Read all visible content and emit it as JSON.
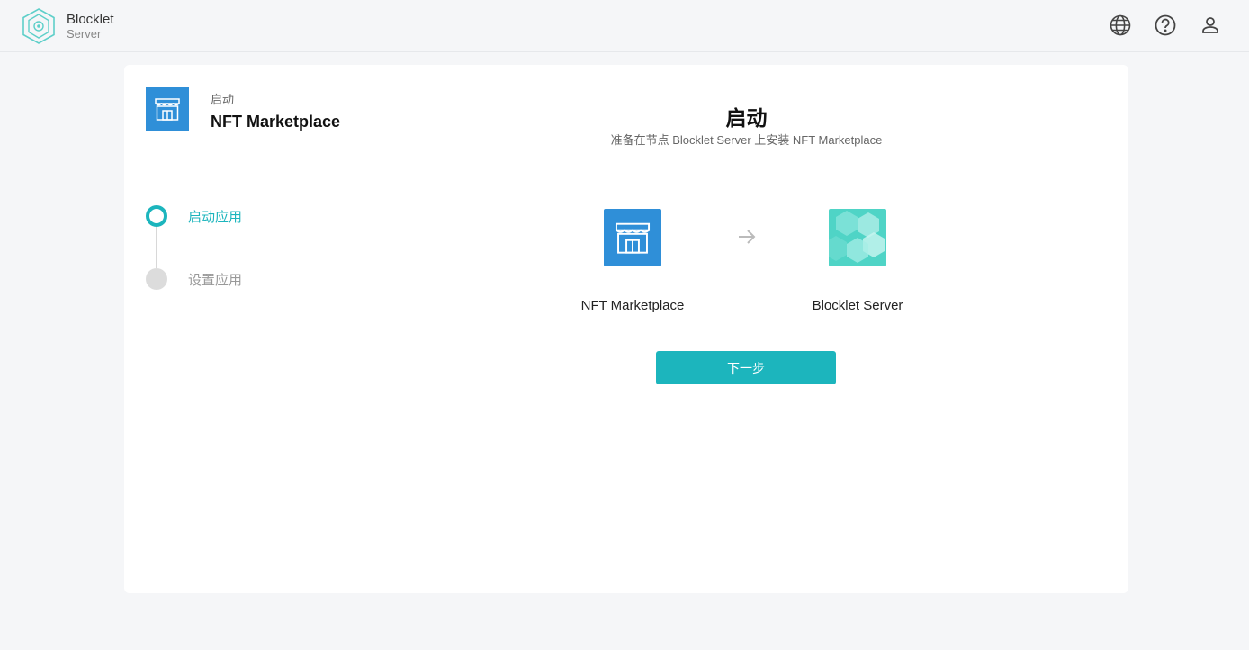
{
  "brand": {
    "name": "Blocklet",
    "sub": "Server"
  },
  "top_icons": [
    "globe-icon",
    "help-icon",
    "user-icon"
  ],
  "app": {
    "label": "启动",
    "name": "NFT Marketplace"
  },
  "steps": [
    {
      "label": "启动应用",
      "state": "active"
    },
    {
      "label": "设置应用",
      "state": "inactive"
    }
  ],
  "main": {
    "title": "启动",
    "subtitle": "准备在节点 Blocklet Server 上安装 NFT Marketplace",
    "source_label": "NFT Marketplace",
    "target_label": "Blocklet Server",
    "next_label": "下一步"
  },
  "colors": {
    "accent": "#1cb5bd",
    "app_blue": "#2f8fd8",
    "server_teal": "#4fd4c6"
  }
}
